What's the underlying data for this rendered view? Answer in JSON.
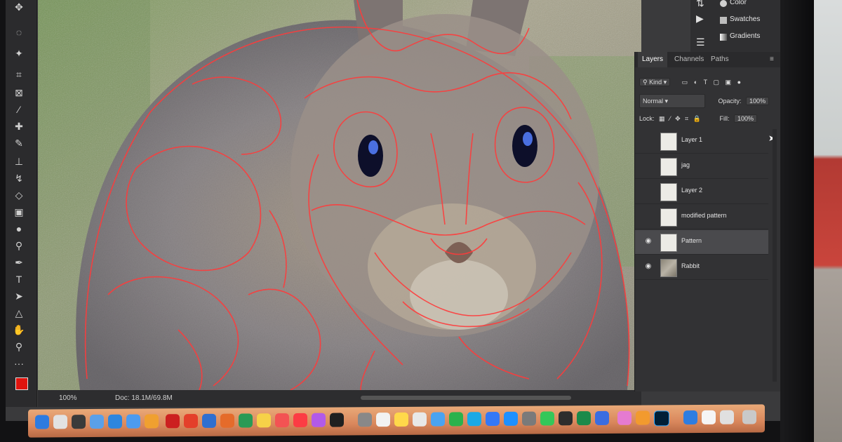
{
  "app": {
    "name": "Photoshop",
    "window": "photo of screen"
  },
  "canvas": {
    "subject": "rabbit-with-red-outline-layer"
  },
  "status_bar": {
    "zoom": "100%",
    "doc": "Doc: 18.1M/69.8M"
  },
  "right_dock": {
    "items": [
      {
        "label": "Color",
        "icon": "color-icon"
      },
      {
        "label": "Swatches",
        "icon": "swatches-icon"
      },
      {
        "label": "Gradients",
        "icon": "gradients-icon"
      }
    ]
  },
  "layers_panel": {
    "tabs": [
      {
        "label": "Layers"
      },
      {
        "label": "Channels"
      },
      {
        "label": "Paths"
      }
    ],
    "filter_kind": "Kind",
    "blend_mode": "Normal",
    "opacity_label": "Opacity:",
    "opacity_value": "100%",
    "lock_label": "Lock:",
    "fill_label": "Fill:",
    "fill_value": "100%",
    "layers": [
      {
        "name": "Layer 1",
        "visible": false,
        "selected": false
      },
      {
        "name": "jag",
        "visible": false,
        "selected": false
      },
      {
        "name": "Layer 2",
        "visible": false,
        "selected": false
      },
      {
        "name": "modified pattern",
        "visible": false,
        "selected": false
      },
      {
        "name": "Pattern",
        "visible": true,
        "selected": true
      },
      {
        "name": "Rabbit",
        "visible": true,
        "selected": false
      }
    ]
  },
  "colors": {
    "foreground": "#e0140e",
    "background": "#ffffff",
    "outline": "#ff3b3b"
  }
}
